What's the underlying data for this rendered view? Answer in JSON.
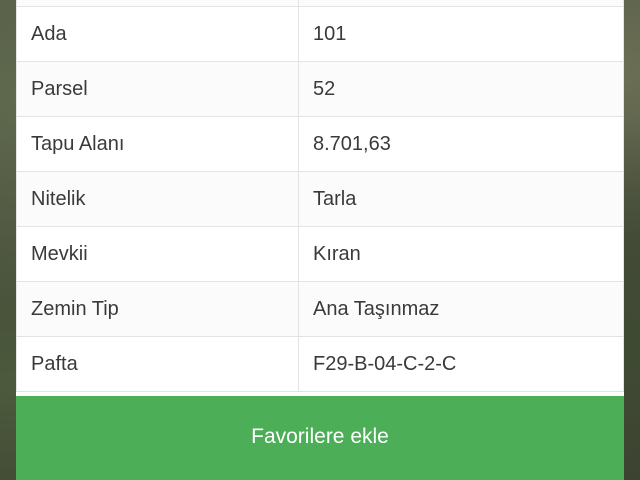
{
  "details": {
    "rows": [
      {
        "key": "",
        "value": ""
      },
      {
        "key": "Ada",
        "value": "101"
      },
      {
        "key": "Parsel",
        "value": "52"
      },
      {
        "key": "Tapu Alanı",
        "value": "8.701,63"
      },
      {
        "key": "Nitelik",
        "value": "Tarla"
      },
      {
        "key": "Mevkii",
        "value": "Kıran"
      },
      {
        "key": "Zemin Tip",
        "value": "Ana Taşınmaz"
      },
      {
        "key": "Pafta",
        "value": "F29-B-04-C-2-C"
      }
    ]
  },
  "actions": {
    "favorite_label": "Favorilere ekle"
  },
  "colors": {
    "accent": "#4cae57",
    "border": "#e3e3e3",
    "text": "#3a3a3a"
  }
}
